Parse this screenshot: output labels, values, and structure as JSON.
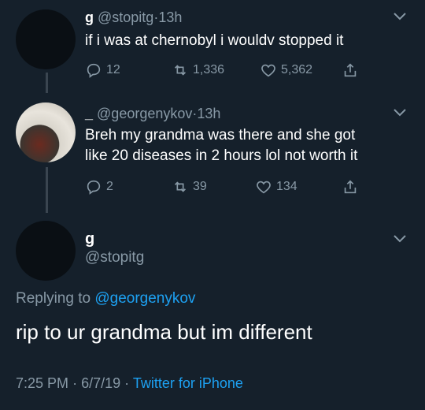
{
  "tweet1": {
    "name": "g",
    "handle": "@stopitg",
    "separator": "·",
    "time": "13h",
    "text": "if i was at chernobyl i wouldv stopped it",
    "replies": "12",
    "retweets": "1,336",
    "likes": "5,362"
  },
  "tweet2": {
    "name": "_",
    "handle": "@georgenykov",
    "separator": "·",
    "time": "13h",
    "text_line1": "Breh my grandma was there and she got",
    "text_line2": "like 20 diseases in 2 hours lol not worth it",
    "replies": "2",
    "retweets": "39",
    "likes": "134"
  },
  "tweet3": {
    "name": "g",
    "handle": "@stopitg",
    "replying_prefix": "Replying to",
    "replying_to": "@georgenykov",
    "text": "rip to ur grandma but im different",
    "time": "7:25 PM",
    "separator1": "·",
    "date": "6/7/19",
    "separator2": "·",
    "client": "Twitter for iPhone"
  },
  "colors": {
    "background": "#15202b",
    "muted": "#8899a6",
    "accent": "#1da1f2"
  },
  "icons": [
    "reply-icon",
    "retweet-icon",
    "like-icon",
    "share-icon",
    "chevron-down-icon"
  ]
}
